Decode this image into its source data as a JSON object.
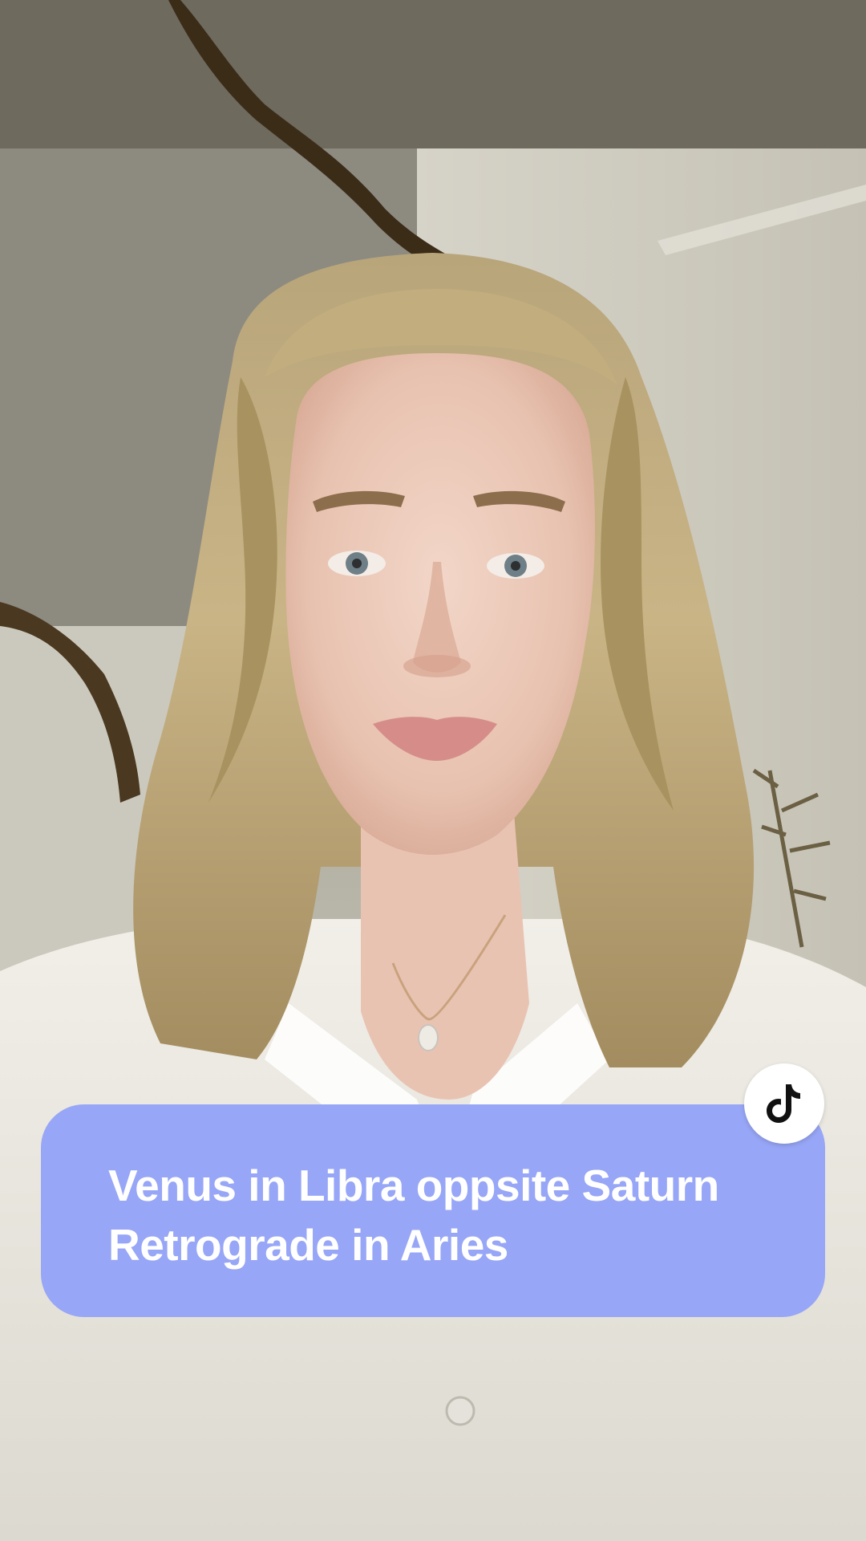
{
  "caption": {
    "line1": "Venus in Libra oppsite Saturn",
    "line2": "Retrograde in Aries"
  },
  "badge": {
    "icon": "tiktok-logo-icon"
  },
  "colors": {
    "caption_background": "#97a6f6",
    "caption_text": "#ffffff",
    "badge_background": "#ffffff",
    "badge_icon": "#111111"
  }
}
